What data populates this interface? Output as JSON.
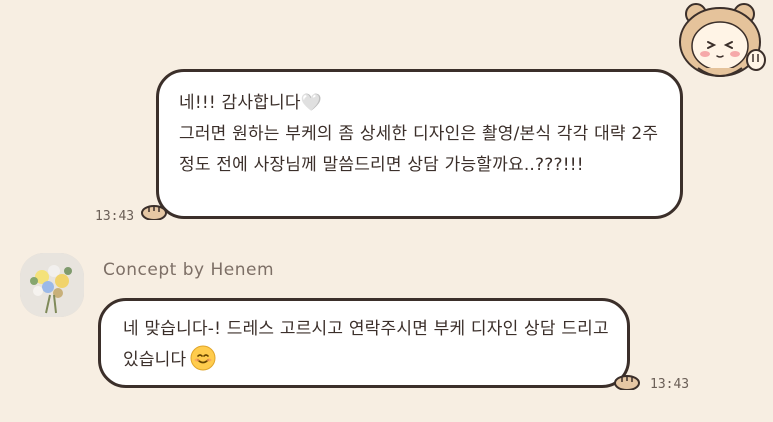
{
  "colors": {
    "background": "#f7eee2",
    "bubble_bg": "#ffffff",
    "bubble_border": "#3b2f2a",
    "text": "#3b2f2a",
    "sender_name": "#7d6f66",
    "paw": "#e6c7a4"
  },
  "messages": {
    "outgoing": {
      "text": "네!!! 감사합니다🤍\n그러면 원하는 부케의 좀 상세한 디자인은 촬영/본식 각각 대략 2주 정도 전에 사장님께 말씀드리면 상담 가능할까요..???!!!",
      "time": "13:43"
    },
    "incoming": {
      "sender": "Concept by Henem",
      "text": "네 맞습니다-! 드레스 고르시고 연락주시면 부케 디자인 상담 드리고있습니다",
      "emoji": "smiling-face",
      "time": "13:43"
    }
  },
  "icons": {
    "sticker": "bear-hood-character-sticker",
    "avatar": "flower-bouquet-avatar",
    "paw": "paw-icon"
  }
}
